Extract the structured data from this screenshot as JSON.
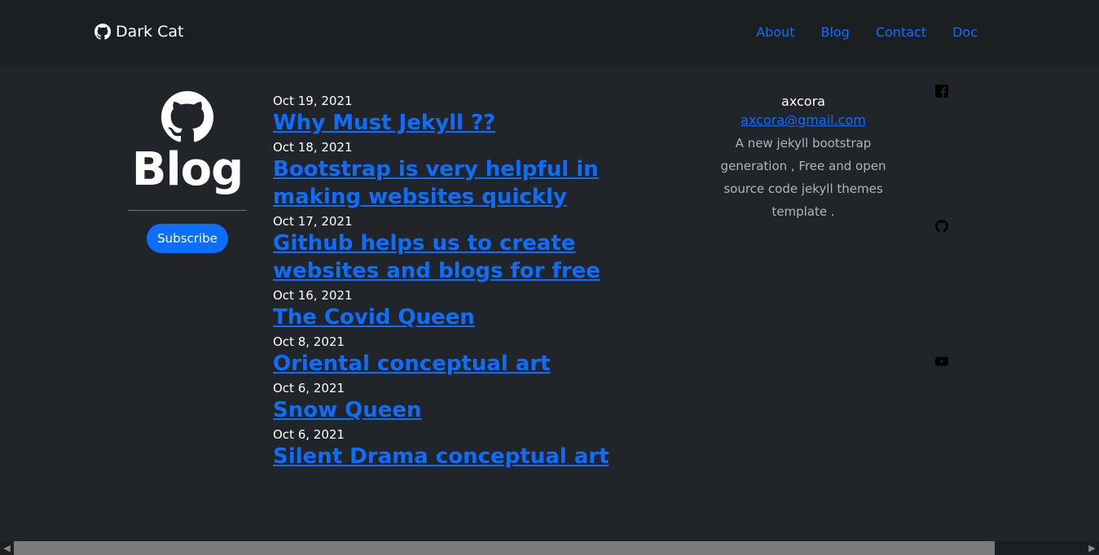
{
  "navbar": {
    "brand": "Dark Cat",
    "links": [
      {
        "label": "About"
      },
      {
        "label": "Blog"
      },
      {
        "label": "Contact"
      },
      {
        "label": "Doc"
      }
    ]
  },
  "sidebar": {
    "title": "Blog",
    "subscribe_label": "Subscribe"
  },
  "posts": [
    {
      "date": "Oct 19, 2021",
      "title": "Why Must Jekyll ??"
    },
    {
      "date": "Oct 18, 2021",
      "title": "Bootstrap is very helpful in making websites quickly"
    },
    {
      "date": "Oct 17, 2021",
      "title": "Github helps us to create websites and blogs for free"
    },
    {
      "date": "Oct 16, 2021",
      "title": "The Covid Queen"
    },
    {
      "date": "Oct 8, 2021",
      "title": "Oriental conceptual art"
    },
    {
      "date": "Oct 6, 2021",
      "title": "Snow Queen"
    },
    {
      "date": "Oct 6, 2021",
      "title": "Silent Drama conceptual art"
    }
  ],
  "about": {
    "author": "axcora",
    "email": "axcora@gmail.com",
    "description": "A new jekyll bootstrap generation , Free and open source code jekyll themes template ."
  },
  "social_icons": [
    "facebook-icon",
    "github-icon",
    "youtube-icon"
  ],
  "colors": {
    "background": "#212529",
    "navbar": "#1c1f22",
    "accent": "#0d6efd"
  }
}
